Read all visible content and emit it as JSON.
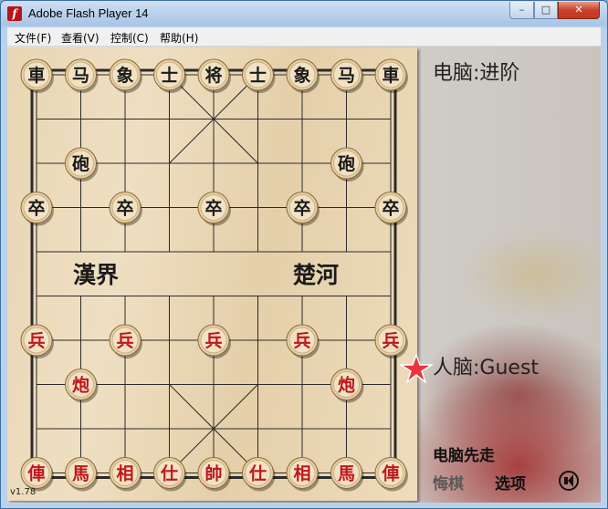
{
  "window": {
    "title": "Adobe Flash Player 14",
    "icon": "flash-player-icon",
    "controls": [
      "minimize",
      "maximize",
      "close"
    ]
  },
  "menu": [
    {
      "label": "文件(F)"
    },
    {
      "label": "查看(V)"
    },
    {
      "label": "控制(C)"
    },
    {
      "label": "帮助(H)"
    }
  ],
  "game": {
    "computer_label": "电脑:进阶",
    "human_label": "人脑:Guest",
    "first_move": "电脑先走",
    "undo_label": "悔棋",
    "options_label": "选项",
    "version": "v1.78",
    "river_left": "漢界",
    "river_right": "楚河",
    "colors": {
      "black_piece": "#1b1b1b",
      "red_piece": "#c0161c",
      "piece_face": "#f1e2c4",
      "active_turn_star": "#e8363b"
    },
    "pieces": [
      {
        "side": "black",
        "label": "車",
        "file": 0,
        "rank": 0
      },
      {
        "side": "black",
        "label": "马",
        "file": 1,
        "rank": 0
      },
      {
        "side": "black",
        "label": "象",
        "file": 2,
        "rank": 0
      },
      {
        "side": "black",
        "label": "士",
        "file": 3,
        "rank": 0
      },
      {
        "side": "black",
        "label": "将",
        "file": 4,
        "rank": 0
      },
      {
        "side": "black",
        "label": "士",
        "file": 5,
        "rank": 0
      },
      {
        "side": "black",
        "label": "象",
        "file": 6,
        "rank": 0
      },
      {
        "side": "black",
        "label": "马",
        "file": 7,
        "rank": 0
      },
      {
        "side": "black",
        "label": "車",
        "file": 8,
        "rank": 0
      },
      {
        "side": "black",
        "label": "砲",
        "file": 1,
        "rank": 2
      },
      {
        "side": "black",
        "label": "砲",
        "file": 7,
        "rank": 2
      },
      {
        "side": "black",
        "label": "卒",
        "file": 0,
        "rank": 3
      },
      {
        "side": "black",
        "label": "卒",
        "file": 2,
        "rank": 3
      },
      {
        "side": "black",
        "label": "卒",
        "file": 4,
        "rank": 3
      },
      {
        "side": "black",
        "label": "卒",
        "file": 6,
        "rank": 3
      },
      {
        "side": "black",
        "label": "卒",
        "file": 8,
        "rank": 3
      },
      {
        "side": "red",
        "label": "兵",
        "file": 0,
        "rank": 6
      },
      {
        "side": "red",
        "label": "兵",
        "file": 2,
        "rank": 6
      },
      {
        "side": "red",
        "label": "兵",
        "file": 4,
        "rank": 6
      },
      {
        "side": "red",
        "label": "兵",
        "file": 6,
        "rank": 6
      },
      {
        "side": "red",
        "label": "兵",
        "file": 8,
        "rank": 6
      },
      {
        "side": "red",
        "label": "炮",
        "file": 1,
        "rank": 7
      },
      {
        "side": "red",
        "label": "炮",
        "file": 7,
        "rank": 7
      },
      {
        "side": "red",
        "label": "俥",
        "file": 0,
        "rank": 9
      },
      {
        "side": "red",
        "label": "馬",
        "file": 1,
        "rank": 9
      },
      {
        "side": "red",
        "label": "相",
        "file": 2,
        "rank": 9
      },
      {
        "side": "red",
        "label": "仕",
        "file": 3,
        "rank": 9
      },
      {
        "side": "red",
        "label": "帥",
        "file": 4,
        "rank": 9
      },
      {
        "side": "red",
        "label": "仕",
        "file": 5,
        "rank": 9
      },
      {
        "side": "red",
        "label": "相",
        "file": 6,
        "rank": 9
      },
      {
        "side": "red",
        "label": "馬",
        "file": 7,
        "rank": 9
      },
      {
        "side": "red",
        "label": "俥",
        "file": 8,
        "rank": 9
      }
    ]
  }
}
